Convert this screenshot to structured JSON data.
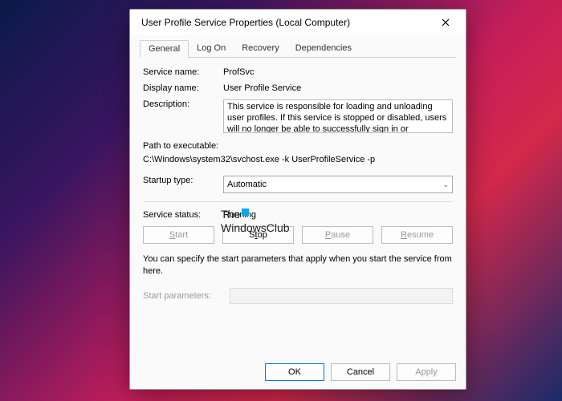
{
  "title": "User Profile Service Properties (Local Computer)",
  "tabs": [
    "General",
    "Log On",
    "Recovery",
    "Dependencies"
  ],
  "labels": {
    "service_name": "Service name:",
    "display_name": "Display name:",
    "description": "Description:",
    "path_label": "Path to executable:",
    "startup_type": "Startup type:",
    "service_status": "Service status:",
    "start_params": "Start parameters:"
  },
  "values": {
    "service_name": "ProfSvc",
    "display_name": "User Profile Service",
    "description": "This service is responsible for loading and unloading user profiles. If this service is stopped or disabled, users will no longer be able to successfully sign in or",
    "path": "C:\\Windows\\system32\\svchost.exe -k UserProfileService -p",
    "startup_type": "Automatic",
    "service_status": "Running"
  },
  "help_text": "You can specify the start parameters that apply when you start the service from here.",
  "buttons": {
    "start": "Start",
    "stop": "Stop",
    "pause": "Pause",
    "resume": "Resume",
    "ok": "OK",
    "cancel": "Cancel",
    "apply": "Apply"
  },
  "watermark": {
    "line1": "The",
    "line2": "WindowsClub"
  }
}
